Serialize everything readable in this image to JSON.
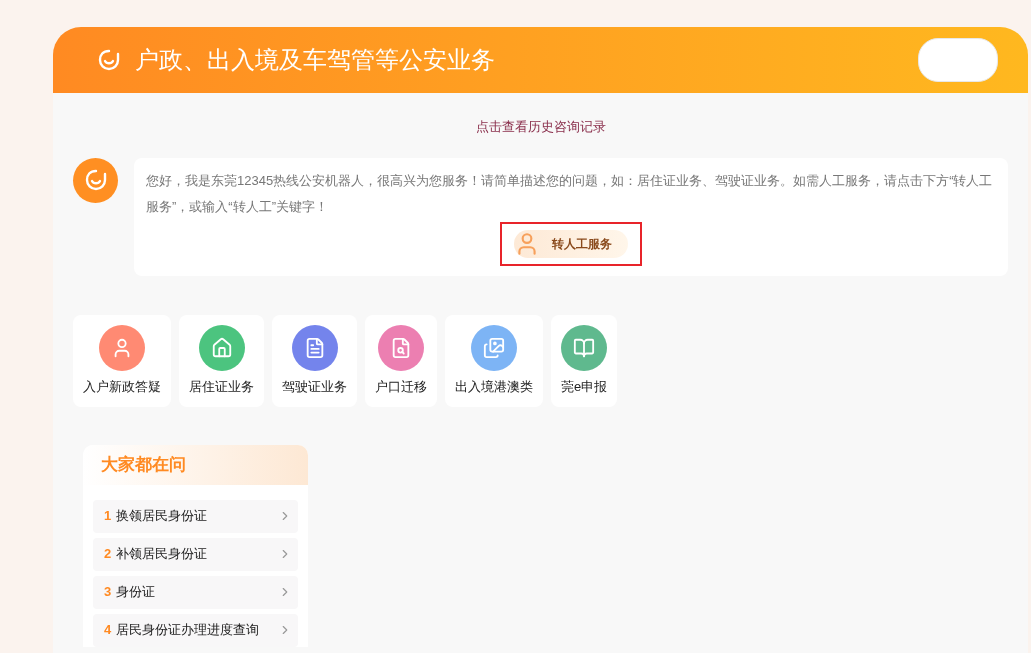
{
  "header": {
    "title": "户政、出入境及车驾管等公安业务"
  },
  "history_link": "点击查看历史咨询记录",
  "bot_message": {
    "text": "您好，我是东莞12345热线公安机器人，很高兴为您服务！请简单描述您的问题，如：居住证业务、驾驶证业务。如需人工服务，请点击下方“转人工服务”，或输入“转人工”关键字！",
    "button": "转人工服务",
    "highlighted": true
  },
  "services": [
    {
      "label": "入户新政答疑",
      "color": "#ff8a73",
      "kind": "person"
    },
    {
      "label": "居住证业务",
      "color": "#4cc47f",
      "kind": "house"
    },
    {
      "label": "驾驶证业务",
      "color": "#7484ec",
      "kind": "document"
    },
    {
      "label": "户口迁移",
      "color": "#ec7fb1",
      "kind": "search"
    },
    {
      "label": "出入境港澳类",
      "color": "#7db4f5",
      "kind": "cards"
    },
    {
      "label": "莞e申报",
      "color": "#5fb98e",
      "kind": "book"
    }
  ],
  "faq": {
    "title": "大家都在问",
    "items": [
      {
        "number": "1",
        "label": "换领居民身份证"
      },
      {
        "number": "2",
        "label": "补领居民身份证"
      },
      {
        "number": "3",
        "label": "身份证"
      },
      {
        "number": "4",
        "label": "居民身份证办理进度查询"
      }
    ]
  }
}
